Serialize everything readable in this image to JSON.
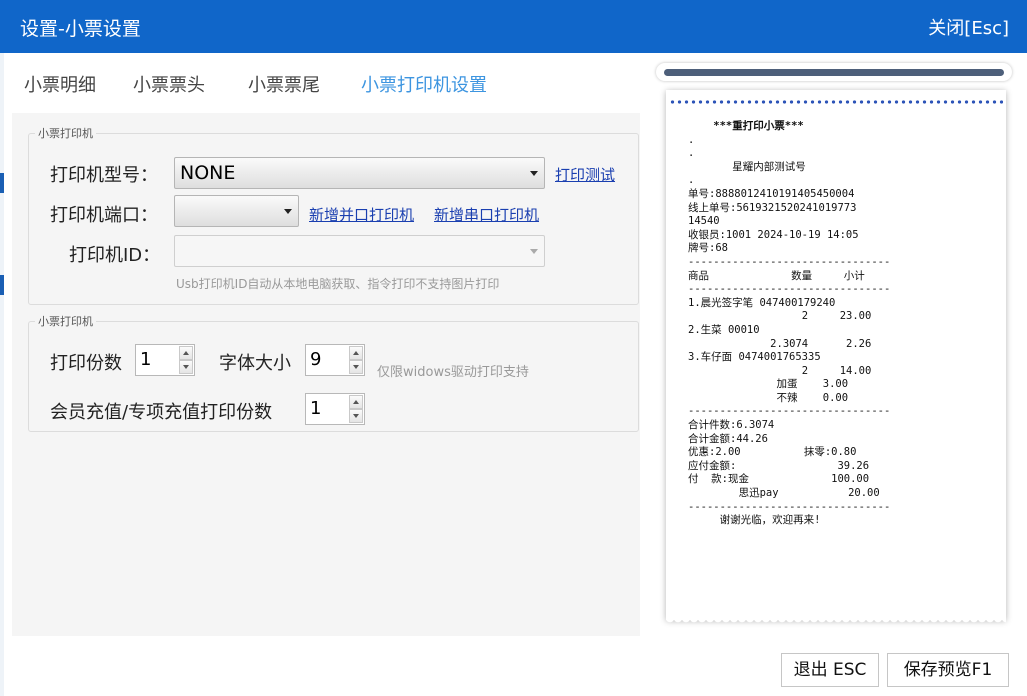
{
  "window": {
    "title": "设置-小票设置",
    "close_label": "关闭[Esc]"
  },
  "tabs": [
    {
      "label": "小票明细",
      "active": false
    },
    {
      "label": "小票票头",
      "active": false
    },
    {
      "label": "小票票尾",
      "active": false
    },
    {
      "label": "小票打印机设置",
      "active": true
    }
  ],
  "printer_group": {
    "legend": "小票打印机",
    "model_label": "打印机型号：",
    "model_value": "NONE",
    "print_test_link": "打印测试",
    "port_label": "打印机端口：",
    "port_value": "",
    "add_parallel_link": "新增并口打印机",
    "add_serial_link": "新增串口打印机",
    "id_label": "打印机ID：",
    "id_value": "",
    "id_hint": "Usb打印机ID自动从本地电脑获取、指令打印不支持图片打印"
  },
  "print_group": {
    "legend": "小票打印机",
    "copies_label": "打印份数",
    "copies_value": "1",
    "font_size_label": "字体大小",
    "font_size_value": "9",
    "font_hint": "仅限widows驱动打印支持",
    "member_copies_label": "会员充值/专项充值打印份数",
    "member_copies_value": "1"
  },
  "receipt": {
    "lines": [
      "    ***重打印小票***",
      ".",
      ".",
      "       星耀内部测试号",
      ".",
      "单号:8888012410191405450004",
      "线上单号:5619321520241019773",
      "14540",
      "收银员:1001 2024-10-19 14:05",
      "牌号:68",
      "--------------------------------",
      "商品             数量     小计",
      "--------------------------------",
      "1.晨光签字笔 047400179240",
      "                  2     23.00",
      "2.生菜 00010",
      "             2.3074      2.26",
      "3.车仔面 0474001765335",
      "                  2     14.00",
      "              加蛋    3.00",
      "              不辣    0.00",
      "--------------------------------",
      "合计件数:6.3074",
      "合计金额:44.26",
      "优惠:2.00          抹零:0.80",
      "应付金额:                39.26",
      "付  款:现金             100.00",
      "        思迅pay           20.00",
      "--------------------------------",
      "     谢谢光临，欢迎再来!"
    ]
  },
  "footer": {
    "exit_label": "退出 ESC",
    "save_label": "保存预览F1"
  },
  "colors": {
    "titlebar": "#1066c9",
    "active_tab": "#3d95e0",
    "link": "#1a3fb0"
  }
}
